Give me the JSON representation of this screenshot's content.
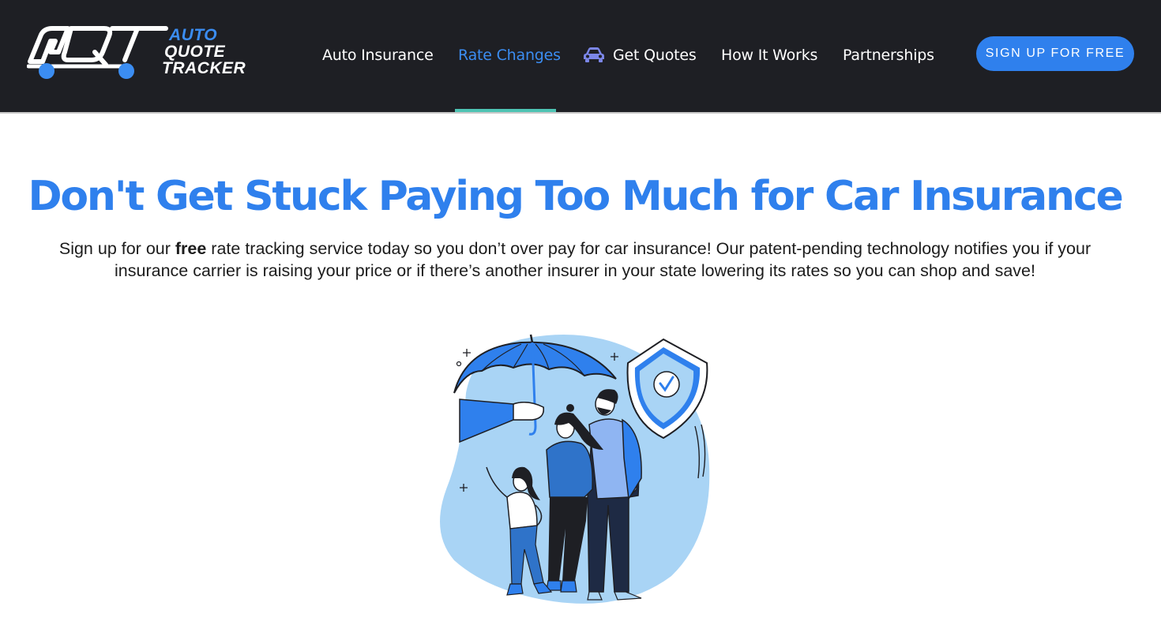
{
  "brand": {
    "logo_mark": "AQT",
    "line1": "AUTO",
    "line2": "QUOTE",
    "line3": "TRACKER",
    "accent_color": "#3b8df2"
  },
  "nav": {
    "items": [
      {
        "label": "Auto Insurance"
      },
      {
        "label": "Rate Changes",
        "active": true
      },
      {
        "label": "Get Quotes",
        "icon": "car-icon"
      },
      {
        "label": "How It Works"
      },
      {
        "label": "Partnerships"
      }
    ],
    "cta_label": "SIGN UP FOR FREE"
  },
  "hero": {
    "headline": "Don't Get Stuck Paying Too Much for Car Insurance",
    "sub_before": "Sign up for our ",
    "sub_bold": "free",
    "sub_after": " rate tracking service today so you don’t over pay for car insurance! Our patent-pending technology notifies you if your insurance carrier is raising your price or if there’s another insurer in your state lowering its rates so you can shop and save!",
    "illustration": "family-umbrella-shield-illustration"
  },
  "colors": {
    "navbar_bg": "#1e1f24",
    "primary_blue": "#2f80ed",
    "active_underline": "#4ec3b3",
    "light_blue_blob": "#a9d4f5"
  }
}
